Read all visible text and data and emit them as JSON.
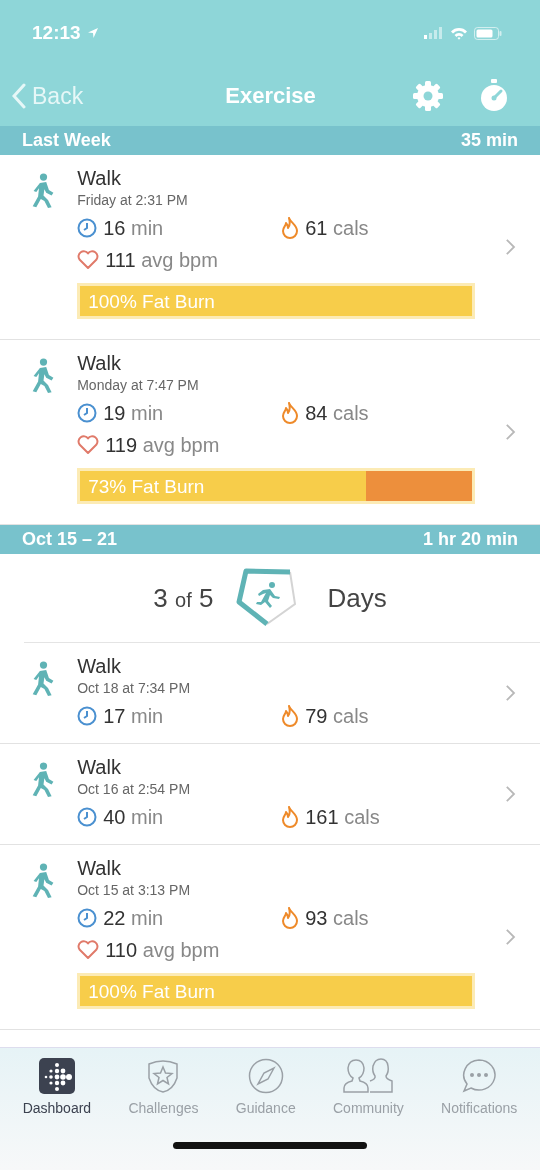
{
  "status_bar": {
    "time": "12:13"
  },
  "nav": {
    "back": "Back",
    "title": "Exercise"
  },
  "sections": [
    {
      "title": "Last Week",
      "total": "35 min",
      "entries": [
        {
          "name": "Walk",
          "when": "Friday at 2:31 PM",
          "duration": {
            "value": "16",
            "unit": "min"
          },
          "cals": {
            "value": "61",
            "unit": "cals"
          },
          "bpm": {
            "value": "111",
            "unit": "avg bpm"
          },
          "fat_burn": {
            "label": "100% Fat Burn",
            "level": 1
          }
        },
        {
          "name": "Walk",
          "when": "Monday at 7:47 PM",
          "duration": {
            "value": "19",
            "unit": "min"
          },
          "cals": {
            "value": "84",
            "unit": "cals"
          },
          "bpm": {
            "value": "119",
            "unit": "avg bpm"
          },
          "fat_burn": {
            "label": "73% Fat Burn",
            "level": 0.73
          }
        }
      ]
    },
    {
      "title": "Oct 15 – 21",
      "total": "1 hr 20 min",
      "goal": {
        "done": "3",
        "of": "of",
        "total": "5",
        "unit": "Days"
      },
      "entries": [
        {
          "name": "Walk",
          "when": "Oct 18 at 7:34 PM",
          "duration": {
            "value": "17",
            "unit": "min"
          },
          "cals": {
            "value": "79",
            "unit": "cals"
          }
        },
        {
          "name": "Walk",
          "when": "Oct 16 at 2:54 PM",
          "duration": {
            "value": "40",
            "unit": "min"
          },
          "cals": {
            "value": "161",
            "unit": "cals"
          }
        },
        {
          "name": "Walk",
          "when": "Oct 15 at 3:13 PM",
          "duration": {
            "value": "22",
            "unit": "min"
          },
          "cals": {
            "value": "93",
            "unit": "cals"
          },
          "bpm": {
            "value": "110",
            "unit": "avg bpm"
          },
          "fat_burn": {
            "label": "100% Fat Burn",
            "level": 1
          }
        }
      ]
    }
  ],
  "tabs": [
    {
      "label": "Dashboard",
      "selected": true
    },
    {
      "label": "Challenges",
      "selected": false
    },
    {
      "label": "Guidance",
      "selected": false
    },
    {
      "label": "Community",
      "selected": false
    },
    {
      "label": "Notifications",
      "selected": false
    }
  ]
}
